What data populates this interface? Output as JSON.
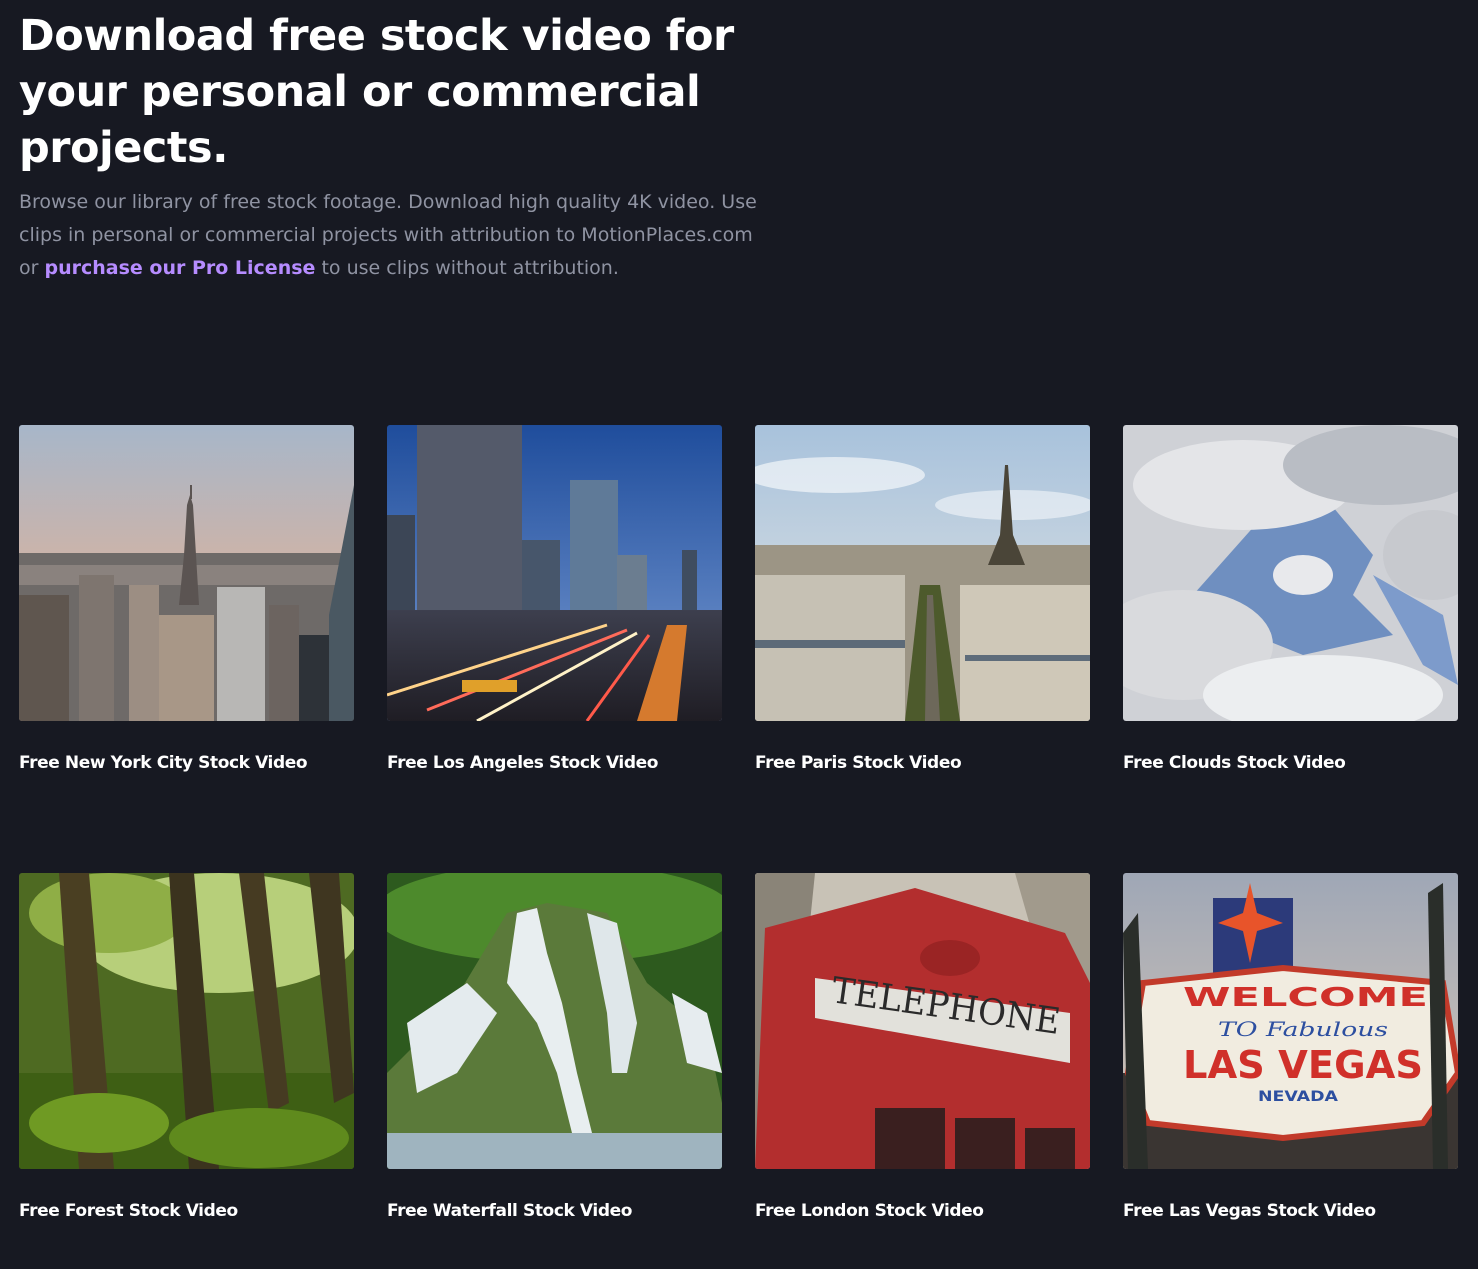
{
  "hero": {
    "heading": "Download free stock video for your personal or commercial projects.",
    "intro_text": "Browse our library of free stock footage. Download high quality 4K video. Use clips in personal or commercial projects with attribution to MotionPlaces.com or",
    "license_link": "purchase our Pro License",
    "outro_text": "to use clips without attribution."
  },
  "cards": [
    {
      "title": "Free New York City Stock Video"
    },
    {
      "title": "Free Los Angeles Stock Video"
    },
    {
      "title": "Free Paris Stock Video"
    },
    {
      "title": "Free Clouds Stock Video"
    },
    {
      "title": "Free Forest Stock Video"
    },
    {
      "title": "Free Waterfall Stock Video"
    },
    {
      "title": "Free London Stock Video"
    },
    {
      "title": "Free Las Vegas Stock Video"
    }
  ],
  "thumb_text": {
    "telephone_sign": "TELEPHONE",
    "welcome": "WELCOME",
    "to_fabulous": "TO Fabulous",
    "las_vegas": "LAS VEGAS",
    "nevada": "NEVADA"
  },
  "colors": {
    "background": "#171922",
    "heading": "#ffffff",
    "body_text": "#8f93a2",
    "link": "#b68cff"
  }
}
